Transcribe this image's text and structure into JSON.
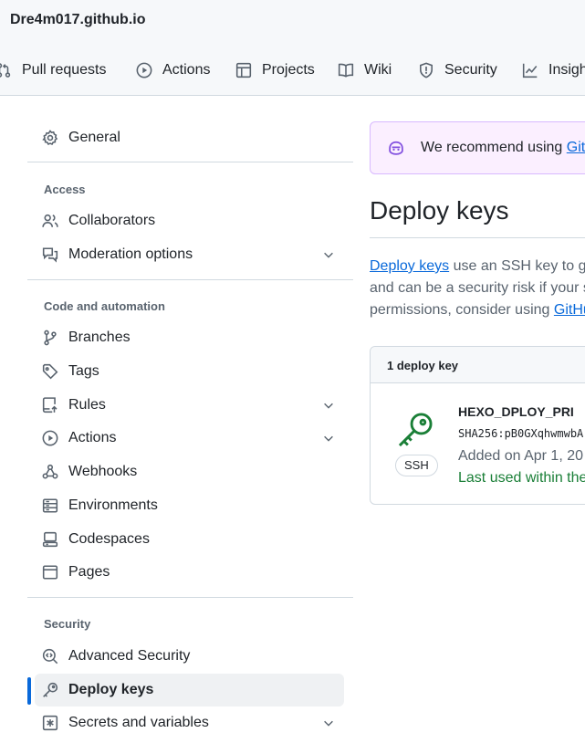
{
  "header": {
    "repo_title": "Dre4m017.github.io",
    "nav": [
      {
        "label": "Pull requests",
        "icon": "git-pull-request-icon"
      },
      {
        "label": "Actions",
        "icon": "play-icon"
      },
      {
        "label": "Projects",
        "icon": "table-icon"
      },
      {
        "label": "Wiki",
        "icon": "book-icon"
      },
      {
        "label": "Security",
        "icon": "shield-icon"
      },
      {
        "label": "Insigh",
        "icon": "graph-icon"
      }
    ]
  },
  "sidebar": {
    "general": "General",
    "sections": [
      {
        "heading": "Access",
        "items": [
          {
            "label": "Collaborators",
            "icon": "people-icon"
          },
          {
            "label": "Moderation options",
            "icon": "comment-discussion-icon",
            "expandable": true
          }
        ]
      },
      {
        "heading": "Code and automation",
        "items": [
          {
            "label": "Branches",
            "icon": "git-branch-icon"
          },
          {
            "label": "Tags",
            "icon": "tag-icon"
          },
          {
            "label": "Rules",
            "icon": "repo-push-icon",
            "expandable": true
          },
          {
            "label": "Actions",
            "icon": "play-icon",
            "expandable": true
          },
          {
            "label": "Webhooks",
            "icon": "webhook-icon"
          },
          {
            "label": "Environments",
            "icon": "server-icon"
          },
          {
            "label": "Codespaces",
            "icon": "codespaces-icon"
          },
          {
            "label": "Pages",
            "icon": "browser-icon"
          }
        ]
      },
      {
        "heading": "Security",
        "items": [
          {
            "label": "Advanced Security",
            "icon": "codescan-icon"
          },
          {
            "label": "Deploy keys",
            "icon": "key-icon",
            "active": true
          },
          {
            "label": "Secrets and variables",
            "icon": "asterisk-icon",
            "expandable": true
          }
        ]
      }
    ]
  },
  "main": {
    "banner": {
      "text": "We recommend using ",
      "link": "Git"
    },
    "title": "Deploy keys",
    "description": {
      "link": "Deploy keys",
      "line1": " use an SSH key to gr",
      "line2": "and can be a security risk if your s",
      "line3_prefix": "permissions, consider using ",
      "line3_link": "GitHu"
    },
    "keys_header": "1 deploy key",
    "key": {
      "name": "HEXO_DPLOY_PRI",
      "fingerprint": "SHA256:pB0GXqhwmwbA",
      "added": "Added on Apr 1, 20",
      "last_used": "Last used within the",
      "badge": "SSH"
    }
  },
  "colors": {
    "accent": "#0969da",
    "key_green": "#1a7f37",
    "banner_bg": "#fbefff",
    "active_bg": "#eff1f3"
  }
}
